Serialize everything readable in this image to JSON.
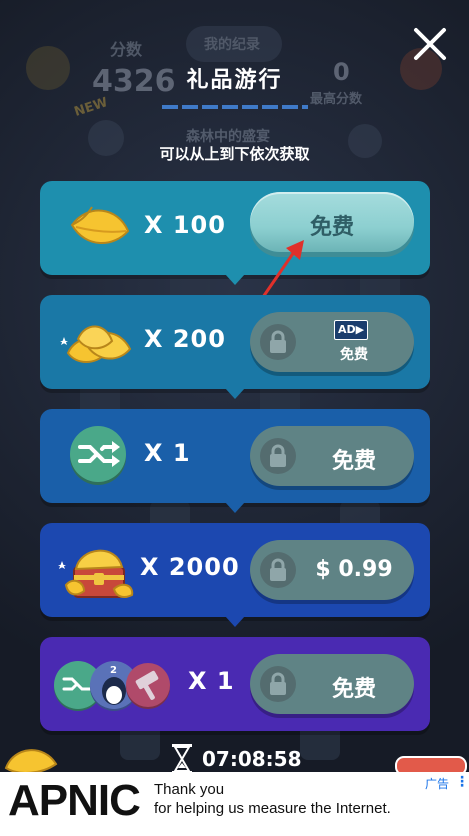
{
  "background": {
    "score_label": "分数",
    "score_value": "4326",
    "records_label": "我的纪录",
    "best_label": "最高分数",
    "best_value": "0",
    "area_label": "森林中的盛宴",
    "new_badge": "NEW"
  },
  "dialog": {
    "title": "礼品游行",
    "subtitle": "可以从上到下依次获取"
  },
  "rewards": [
    {
      "icon": "leaf-icon",
      "quantity": "X 100",
      "button": "免费",
      "state": "available",
      "color": "#1e8fae"
    },
    {
      "icon": "leaf-pile-icon",
      "quantity": "X 200",
      "button": "免费",
      "ad_badge": "AD▶",
      "state": "locked",
      "color": "#1a78a6"
    },
    {
      "icon": "shuffle-icon",
      "quantity": "X 1",
      "button": "免费",
      "state": "locked",
      "color": "#1a5fa9"
    },
    {
      "icon": "treasure-chest-icon",
      "quantity": "X 2000",
      "button": "$ 0.99",
      "state": "locked",
      "color": "#1c48b0"
    },
    {
      "icon": "powerup-bundle-icon",
      "quantity": "X 1",
      "button": "免费",
      "state": "locked",
      "color": "#4a2ab2"
    }
  ],
  "timer": {
    "value": "07:08:58"
  },
  "ad": {
    "logo": "APNIC",
    "line1": "Thank you",
    "line2": "for helping us measure the Internet.",
    "tag": "广告"
  }
}
